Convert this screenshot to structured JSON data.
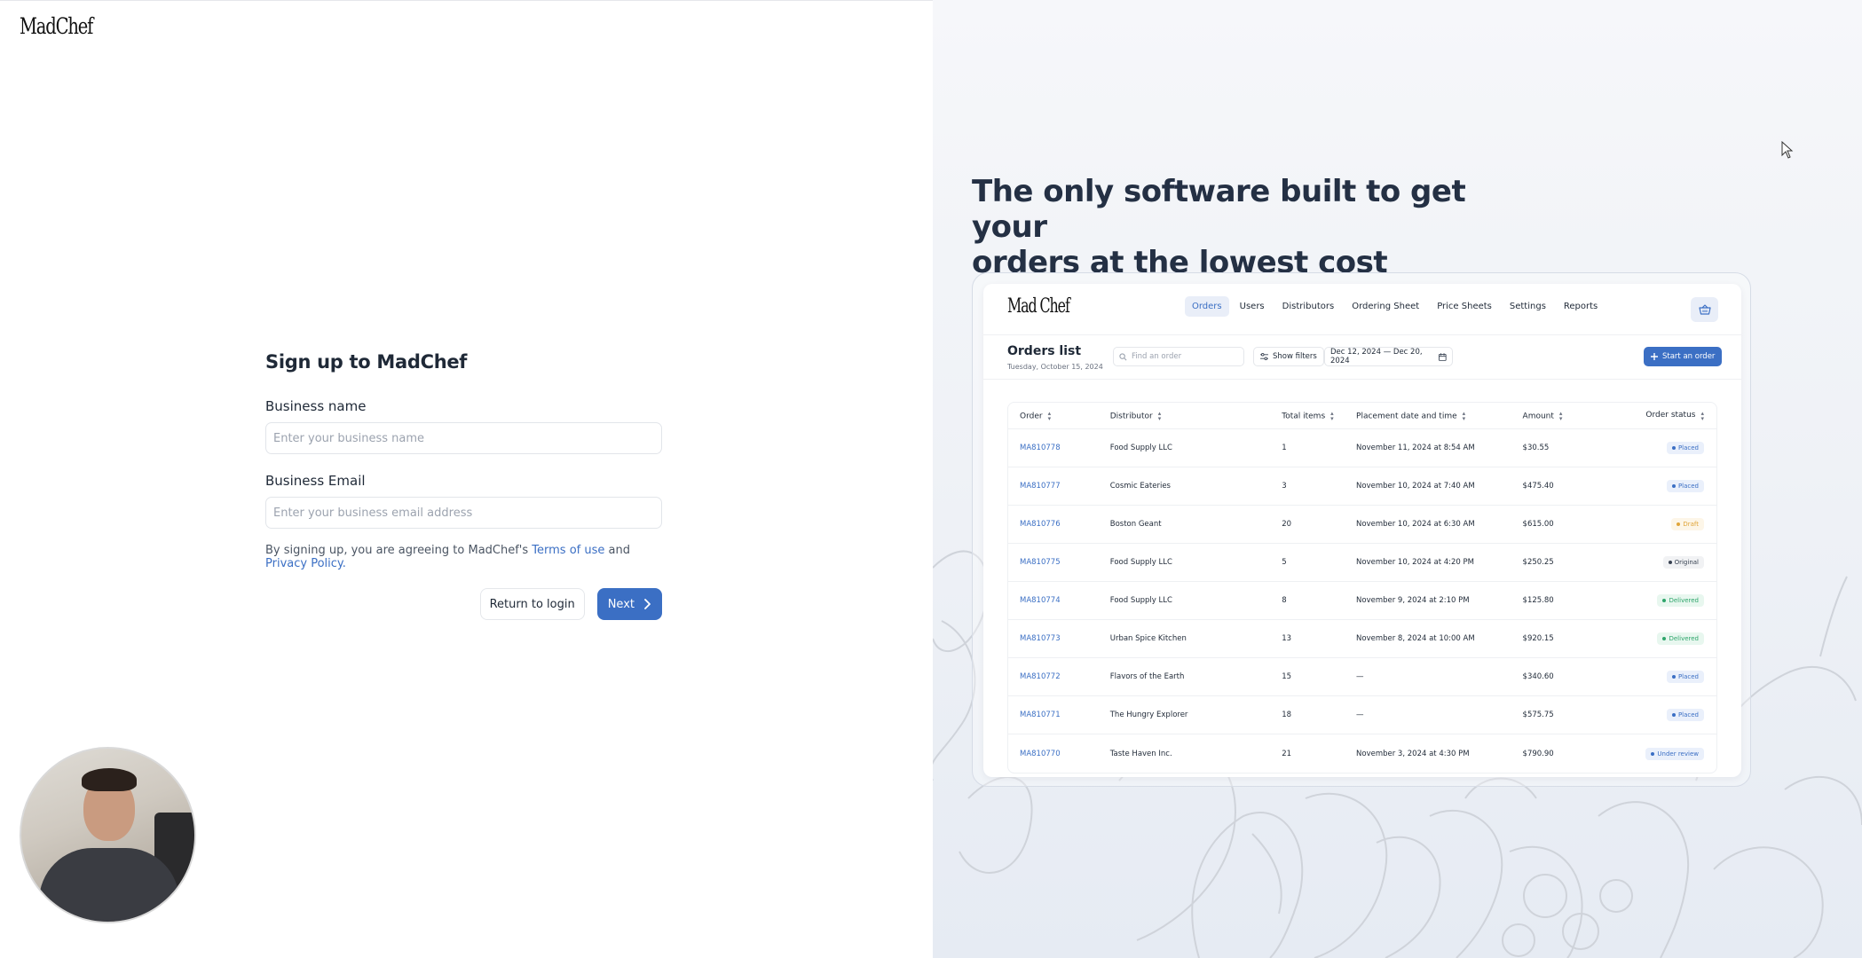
{
  "brand": {
    "logo_text": "MadChef"
  },
  "signup": {
    "title": "Sign up to MadChef",
    "business_name_label": "Business name",
    "business_name_placeholder": "Enter your business name",
    "business_email_label": "Business Email",
    "business_email_placeholder": "Enter your business email address",
    "terms_prefix": "By signing up, you are agreeing to MadChef's",
    "terms_link": "Terms of use",
    "terms_and": "and",
    "privacy_link": "Privacy Policy.",
    "return_button": "Return to login",
    "next_button": "Next"
  },
  "hero": {
    "headline_line1": "The only software built to get your",
    "headline_line2": "orders at the lowest cost"
  },
  "mock": {
    "logo_text": "Mad Chef",
    "nav": [
      "Orders",
      "Users",
      "Distributors",
      "Ordering Sheet",
      "Price Sheets",
      "Settings",
      "Reports"
    ],
    "active_nav": "Orders",
    "list_title": "Orders list",
    "list_date": "Tuesday, October 15, 2024",
    "search_placeholder": "Find an order",
    "filters_label": "Show filters",
    "date_range": "Dec 12, 2024 — Dec 20, 2024",
    "start_order_label": "Start an order",
    "columns": [
      "Order",
      "Distributor",
      "Total items",
      "Placement date and time",
      "Amount",
      "Order status"
    ],
    "rows": [
      {
        "order": "MA810778",
        "distributor": "Food Supply LLC",
        "items": "1",
        "placed": "November 11, 2024 at 8:54 AM",
        "amount": "$30.55",
        "status": "Placed"
      },
      {
        "order": "MA810777",
        "distributor": "Cosmic Eateries",
        "items": "3",
        "placed": "November 10, 2024 at 7:40 AM",
        "amount": "$475.40",
        "status": "Placed"
      },
      {
        "order": "MA810776",
        "distributor": "Boston Geant",
        "items": "20",
        "placed": "November 10, 2024 at 6:30 AM",
        "amount": "$615.00",
        "status": "Draft"
      },
      {
        "order": "MA810775",
        "distributor": "Food Supply LLC",
        "items": "5",
        "placed": "November 10, 2024 at 4:20 PM",
        "amount": "$250.25",
        "status": "Original"
      },
      {
        "order": "MA810774",
        "distributor": "Food Supply LLC",
        "items": "8",
        "placed": "November 9, 2024 at 2:10 PM",
        "amount": "$125.80",
        "status": "Delivered"
      },
      {
        "order": "MA810773",
        "distributor": "Urban Spice Kitchen",
        "items": "13",
        "placed": "November 8, 2024 at 10:00 AM",
        "amount": "$920.15",
        "status": "Delivered"
      },
      {
        "order": "MA810772",
        "distributor": "Flavors of the Earth",
        "items": "15",
        "placed": "—",
        "amount": "$340.60",
        "status": "Placed"
      },
      {
        "order": "MA810771",
        "distributor": "The Hungry Explorer",
        "items": "18",
        "placed": "—",
        "amount": "$575.75",
        "status": "Placed"
      },
      {
        "order": "MA810770",
        "distributor": "Taste Haven Inc.",
        "items": "21",
        "placed": "November 3, 2024 at 4:30 PM",
        "amount": "$790.90",
        "status": "Under review"
      }
    ],
    "status_colors": {
      "Placed": {
        "fg": "#3b6fc4",
        "bg": "#eaf0fb"
      },
      "Draft": {
        "fg": "#e0a53a",
        "bg": "#fdf6e8"
      },
      "Original": {
        "fg": "#374151",
        "bg": "#f1f2f4"
      },
      "Delivered": {
        "fg": "#2ea56b",
        "bg": "#e8f7ef"
      },
      "Under review": {
        "fg": "#3b6fc4",
        "bg": "#eaf0fb"
      }
    }
  },
  "colors": {
    "accent": "#3b6fc4",
    "heading": "#243044"
  },
  "icons": {
    "next": "chevron-right-icon",
    "cart": "basket-icon",
    "search": "search-icon",
    "filters": "sliders-icon",
    "calendar": "calendar-icon",
    "add": "plus-icon",
    "cursor": "mouse-pointer-icon"
  }
}
